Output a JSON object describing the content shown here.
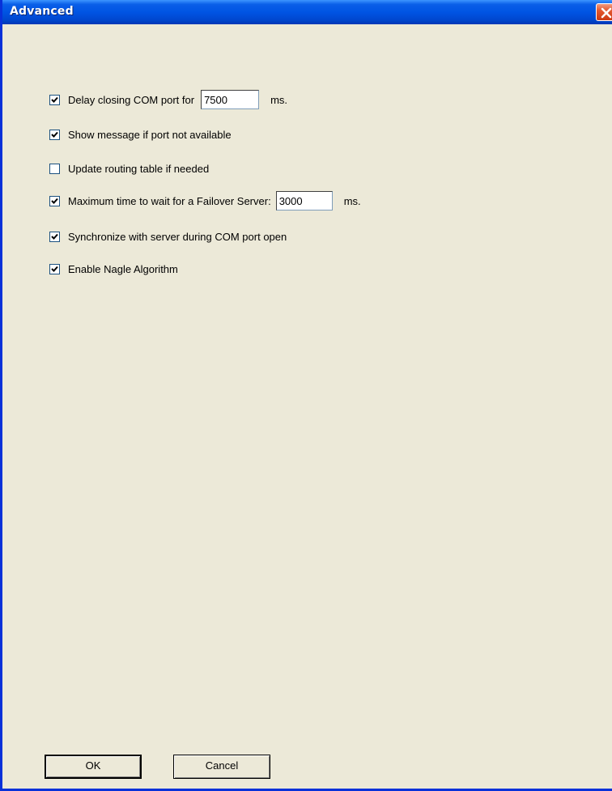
{
  "window": {
    "title": "Advanced"
  },
  "options": [
    {
      "label": "Delay closing COM port for",
      "checked": true,
      "value": "7500",
      "unit": "ms."
    },
    {
      "label": "Show message if port not available",
      "checked": true
    },
    {
      "label": "Update routing table if needed",
      "checked": false
    },
    {
      "label": "Maximum time to wait for a Failover Server:",
      "checked": true,
      "value": "3000",
      "unit": "ms."
    },
    {
      "label": "Synchronize with server during COM port open",
      "checked": true
    },
    {
      "label": "Enable Nagle Algorithm",
      "checked": true
    }
  ],
  "buttons": {
    "ok_label": "OK",
    "cancel_label": "Cancel"
  },
  "colors": {
    "titlebar": "#0054e3",
    "dialog_bg": "#ece9d8",
    "close_button": "#e3582f"
  },
  "icons": {
    "close": "close-icon",
    "check": "checkmark-icon"
  }
}
